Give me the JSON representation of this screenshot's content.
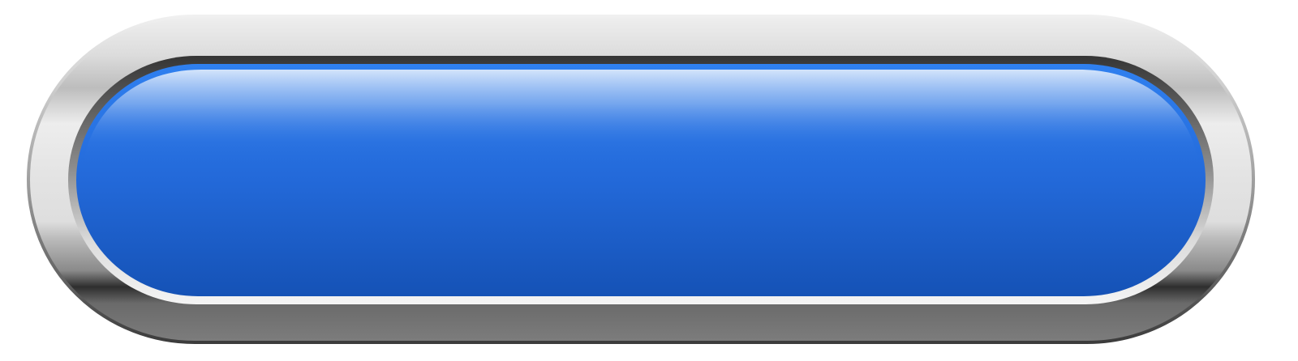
{
  "button": {
    "label": "",
    "colors": {
      "face_top": "#c9ddf9",
      "face_mid": "#2369d9",
      "face_bottom": "#1653b8",
      "face_rim": "#2f80f0",
      "bezel_light": "#e6e6e6",
      "bezel_dark": "#2e2e2e",
      "bezel_outline": "#444444",
      "inner_ring_dark": "#3a3a3a",
      "inner_ring_light": "#f2f2f2"
    },
    "icon": "none"
  }
}
